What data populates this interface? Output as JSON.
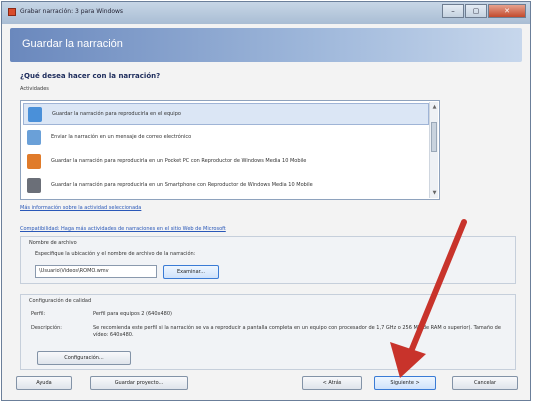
{
  "window": {
    "title": "Grabar narración: 3 para Windows",
    "controls": {
      "minimize": "–",
      "maximize": "▢",
      "close": "✕"
    }
  },
  "header": {
    "title": "Guardar la narración"
  },
  "question": "¿Qué desea hacer con la narración?",
  "activities_label": "Actividades",
  "activities": [
    {
      "label": "Guardar la narración para reproducirla en el equipo",
      "icon": "computer-icon",
      "color": "#4a90d9",
      "selected": true
    },
    {
      "label": "Enviar la narración en un mensaje de correo electrónico",
      "icon": "envelope-icon",
      "color": "#6aa0d8",
      "selected": false
    },
    {
      "label": "Guardar la narración para reproducirla en un Pocket PC con Reproductor de Windows Media 10 Mobile",
      "icon": "pocket-pc-icon",
      "color": "#e07b2a",
      "selected": false
    },
    {
      "label": "Guardar la narración para reproducirla en un Smartphone con Reproductor de Windows Media 10 Mobile",
      "icon": "smartphone-icon",
      "color": "#6b6f78",
      "selected": false
    }
  ],
  "links": {
    "more_info": "Más información sobre la actividad seleccionada",
    "compatibility": "Compatibilidad: Haga más actividades de narraciones en el sitio Web de Microsoft"
  },
  "file_group": {
    "title": "Nombre de archivo",
    "instruction": "Especifique la ubicación y el nombre de archivo de la narración:",
    "path_value": "\\Usuario\\Videos\\ROMO.wmv",
    "browse_label": "Examinar..."
  },
  "quality_group": {
    "title": "Configuración de calidad",
    "profile_label": "Perfil:",
    "profile_value": "Perfil para equipos 2 (640x480)",
    "description_label": "Descripción:",
    "description_value": "Se recomienda este perfil si la narración se va a reproducir a pantalla completa en un equipo con procesador de 1,7 GHz o 256 MB de RAM o superior). Tamaño de vídeo: 640x480.",
    "settings_label": "Configuración..."
  },
  "footer": {
    "help": "Ayuda",
    "save_project": "Guardar proyecto...",
    "back": "< Atrás",
    "next": "Siguiente >",
    "cancel": "Cancelar"
  },
  "annotation": {
    "arrow_color": "#c8332b"
  }
}
